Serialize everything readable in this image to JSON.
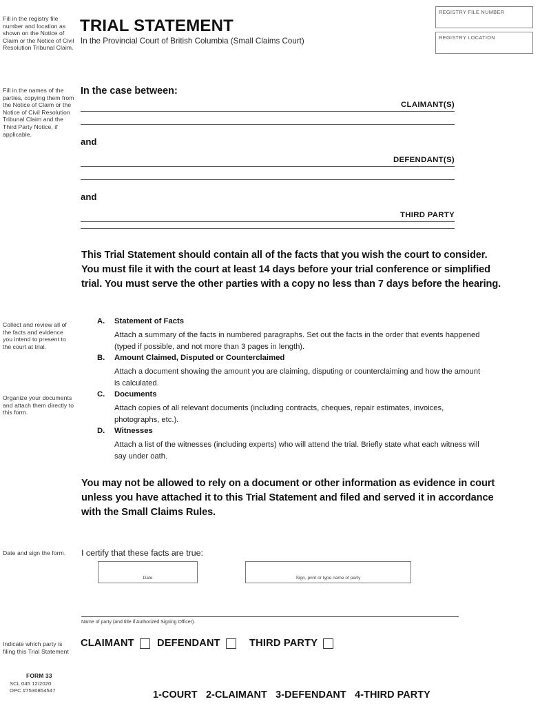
{
  "header": {
    "title": "TRIAL STATEMENT",
    "subtitle": "In the Provincial Court of British Columbia (Small Claims Court)",
    "registry_file_number_label": "REGISTRY FILE NUMBER",
    "registry_file_number_value": "",
    "registry_location_label": "REGISTRY LOCATION",
    "registry_location_value": ""
  },
  "margin_notes": {
    "registry": "Fill in the registry file number and location as shown on the Notice of Claim or the Notice of Civil Resolution Tribunal Claim.",
    "parties": "Fill in the names of the parties, copying them from the Notice of Claim or the Notice of Civil Resolution Tribunal Claim and the Third Party Notice, if applicable.",
    "facts": "Collect and review all of the facts and evidence you intend to present to the court at trial.",
    "documents": "Organize your documents and attach them directly to this form.",
    "sign": "Date and sign the form.",
    "indicate_party": "Indicate which party is filing this Trial Statement"
  },
  "parties": {
    "case_between": "In the case between:",
    "and_1": "and",
    "and_2": "and",
    "claimant_label": "CLAIMANT(S)",
    "defendant_label": "DEFENDANT(S)",
    "third_party_label": "THIRD PARTY",
    "claimant_value": "",
    "defendant_value": "",
    "third_party_value": ""
  },
  "notices": {
    "filing_requirement": "This Trial Statement should contain all of the facts that you wish the court to consider. You must file it with the court at least 14 days before your trial conference or simplified trial. You must serve the other parties with a copy no less than 7 days before the hearing.",
    "evidence_warning": "You may not be allowed to rely on a document or other information as evidence in court unless you have attached it to this Trial Statement and filed and served it in accordance with the Small Claims Rules."
  },
  "items": [
    {
      "letter": "A.",
      "heading": "Statement of Facts",
      "body": "Attach a summary of the facts in numbered paragraphs.  Set out the facts in the order that events happened (typed if possible, and not more than 3 pages in length)."
    },
    {
      "letter": "B.",
      "heading": "Amount Claimed, Disputed or Counterclaimed",
      "body": "Attach a document showing the amount you are claiming, disputing or counterclaiming and how the amount is calculated."
    },
    {
      "letter": "C.",
      "heading": "Documents",
      "body": "Attach copies of all relevant documents (including contracts, cheques, repair estimates, invoices, photographs, etc.)."
    },
    {
      "letter": "D.",
      "heading": "Witnesses",
      "body": "Attach a list of the witnesses (including experts) who will attend the trial.  Briefly state what each witness will say under oath."
    }
  ],
  "certification": {
    "statement": "I certify that these facts are true:",
    "date_caption": "Date",
    "date_value": "",
    "signature_caption": "Sign, print or type name of party",
    "signature_value": "",
    "name_of_party_caption": "Name of party (and title if Authorized Signing Officer).",
    "name_of_party_value": ""
  },
  "filing_party": [
    {
      "label": "CLAIMANT",
      "checked": false
    },
    {
      "label": "DEFENDANT",
      "checked": false
    },
    {
      "label": "THIRD PARTY",
      "checked": false
    }
  ],
  "footer": {
    "form_number": "FORM 33",
    "form_code": "SCL 045   12/2020",
    "form_opc": "OPC #7530854547",
    "copy_distribution": "1-COURT   2-CLAIMANT   3-DEFENDANT   4-THIRD PARTY"
  }
}
